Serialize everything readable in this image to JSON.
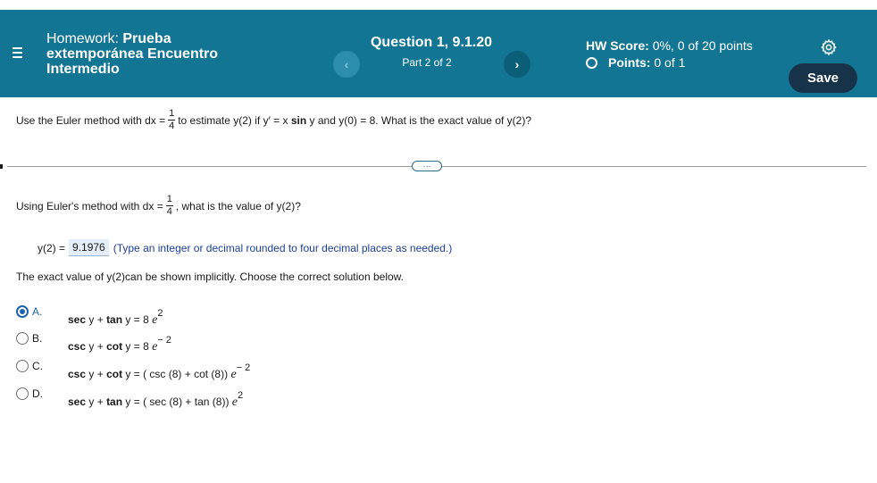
{
  "header": {
    "hw_prefix": "Homework: ",
    "hw_name_line1": "Prueba",
    "hw_name_line2": "extemporánea Encuentro",
    "hw_name_line3": "Intermedio",
    "question_title": "Question 1, 9.1.20",
    "question_part": "Part 2 of 2",
    "prev_icon": "‹",
    "next_icon": "›",
    "hw_score_label": "HW Score:",
    "hw_score_value": "0%, 0 of 20 points",
    "points_label": "Points:",
    "points_value": "0 of 1",
    "save_label": "Save",
    "colors": {
      "header_bg": "#137594",
      "save_bg": "#16334a"
    }
  },
  "question": {
    "text_a": "Use the Euler method with dx =",
    "frac_num": "1",
    "frac_den": "4",
    "text_b": "to estimate y(2) if y′ = x",
    "sin": "sin",
    "text_c": "y and y(0) = 8.  What is the exact value of y(2)?"
  },
  "more_label": "···",
  "part2": {
    "text_a": "Using Euler's method with dx =",
    "frac_num": "1",
    "frac_den": "4",
    "text_b": ", what is the value of y(2)?",
    "answer_label": "y(2) =",
    "answer_value": "9.1976",
    "answer_hint": "(Type an integer or decimal rounded to four decimal places as needed.)",
    "instruction": "The exact value of y(2)can be shown implicitly.  Choose the correct solution below."
  },
  "options": [
    {
      "letter": "A.",
      "f1": "sec",
      "f2": "y +",
      "f3": "tan",
      "f4": "y = 8",
      "e": "e",
      "exp": "2",
      "selected": true
    },
    {
      "letter": "B.",
      "f1": "csc",
      "f2": "y +",
      "f3": "cot",
      "f4": "y = 8",
      "e": "e",
      "exp": "− 2",
      "selected": false
    },
    {
      "letter": "C.",
      "f1": "csc",
      "f2": "y +",
      "f3": "cot",
      "f4": "y = ( csc (8) + cot (8))",
      "e": "e",
      "exp": "− 2",
      "selected": false
    },
    {
      "letter": "D.",
      "f1": "sec",
      "f2": "y +",
      "f3": "tan",
      "f4": "y = ( sec (8) + tan (8))",
      "e": "e",
      "exp": "2",
      "selected": false
    }
  ]
}
